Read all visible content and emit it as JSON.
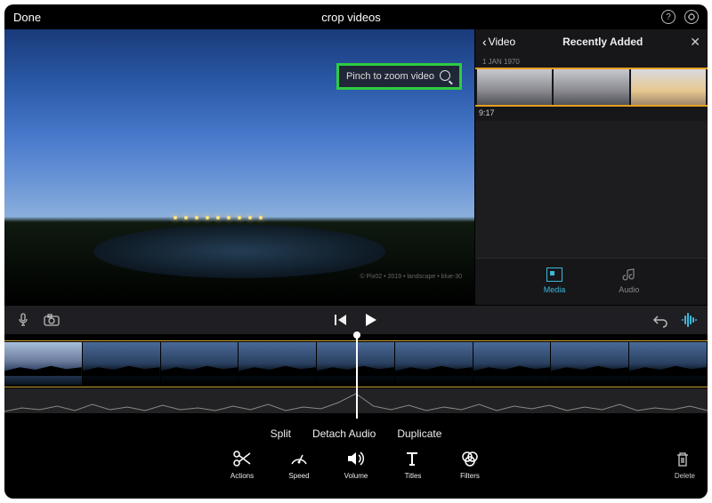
{
  "header": {
    "done_label": "Done",
    "title": "crop videos"
  },
  "preview": {
    "zoom_tip": "Pinch to zoom video"
  },
  "library": {
    "back_label": "Video",
    "title": "Recently Added",
    "date_label": "1 JAN 1970",
    "clip_duration": "9:17",
    "tabs": {
      "media": "Media",
      "audio": "Audio"
    }
  },
  "text_actions": {
    "split": "Split",
    "detach_audio": "Detach Audio",
    "duplicate": "Duplicate"
  },
  "tools": {
    "actions": "Actions",
    "speed": "Speed",
    "volume": "Volume",
    "titles": "Titles",
    "filters": "Filters",
    "delete": "Delete"
  }
}
